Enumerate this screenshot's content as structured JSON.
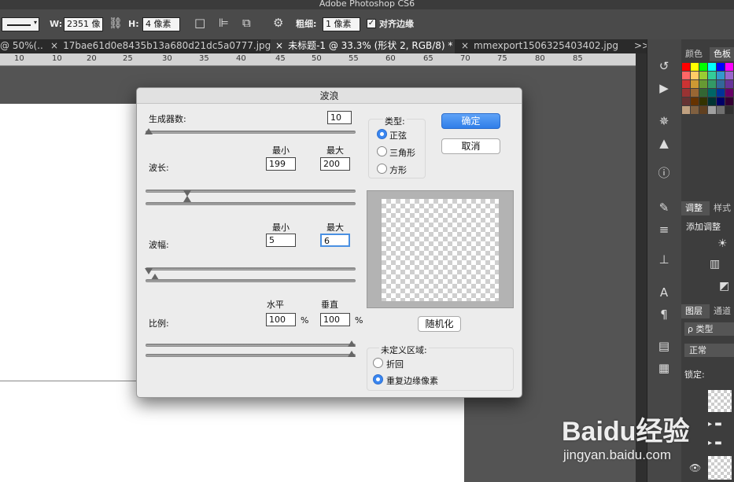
{
  "app": {
    "title": "Adobe Photoshop CS6"
  },
  "options_bar": {
    "w_label": "W:",
    "w_value": "2351 像",
    "h_label": "H:",
    "h_value": "4 像素",
    "stroke_label": "粗细:",
    "stroke_value": "1 像素",
    "align_edges_label": "对齐边缘",
    "align_edges_checked": true
  },
  "tabs": [
    {
      "label": "@ 50%(..."
    },
    {
      "label": "17bae61d0e8435b13a680d21dc5a0777.jpg"
    },
    {
      "label": "未标题-1 @ 33.3% (形状 2, RGB/8) *"
    },
    {
      "label": "mmexport1506325403402.jpg"
    },
    {
      "label": ">>"
    }
  ],
  "ruler": {
    "ticks": [
      "10",
      "10",
      "15",
      "20",
      "25",
      "30",
      "35",
      "40",
      "45",
      "50",
      "55",
      "60",
      "65",
      "70",
      "75",
      "80",
      "85"
    ]
  },
  "right_panels": {
    "swatch_tabs": [
      "颜色",
      "色板"
    ],
    "adjust_tabs": [
      "调整",
      "样式"
    ],
    "adjust_add": "添加调整",
    "layer_tabs": [
      "图层",
      "通道"
    ],
    "layer_kind": "ρ 类型",
    "blend_mode": "正常",
    "lock_label": "锁定:"
  },
  "swatches": [
    "#ff0000",
    "#ffff00",
    "#00ff00",
    "#00ffff",
    "#0000ff",
    "#ff00ff",
    "#ff6666",
    "#ffcc66",
    "#99cc33",
    "#33cc99",
    "#3399cc",
    "#9966cc",
    "#cc3333",
    "#cc9933",
    "#669933",
    "#339966",
    "#336699",
    "#663399",
    "#993333",
    "#996633",
    "#336633",
    "#006666",
    "#003399",
    "#660066",
    "#663333",
    "#663300",
    "#333300",
    "#003333",
    "#000066",
    "#330033",
    "#c0a080",
    "#806040",
    "#604020",
    "#a0a0a0",
    "#707070",
    "#303030"
  ],
  "dialog": {
    "title": "波浪",
    "generators_label": "生成器数:",
    "generators_value": "10",
    "wavelength_label": "波长:",
    "min_label": "最小",
    "max_label": "最大",
    "wavelength_min": "199",
    "wavelength_max": "200",
    "amplitude_label": "波幅:",
    "amplitude_min": "5",
    "amplitude_max": "6",
    "scale_label": "比例:",
    "horizontal_label": "水平",
    "vertical_label": "垂直",
    "scale_h": "100",
    "scale_v": "100",
    "percent": "%",
    "type_label": "类型:",
    "types": [
      "正弦",
      "三角形",
      "方形"
    ],
    "selected_type": "正弦",
    "ok_label": "确定",
    "cancel_label": "取消",
    "randomize_label": "随机化",
    "undefined_label": "未定义区域:",
    "undefined_options": [
      "折回",
      "重复边缘像素"
    ],
    "selected_undefined": "重复边缘像素"
  },
  "watermark": {
    "brand": "Baidu经验",
    "url": "jingyan.baidu.com"
  }
}
